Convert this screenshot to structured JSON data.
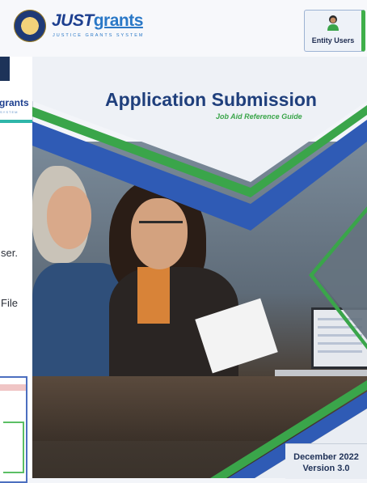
{
  "header": {
    "logo_main": "JUST",
    "logo_grants": "grants",
    "logo_sub": "JUSTICE GRANTS SYSTEM",
    "entity_users_label": "Entity Users"
  },
  "inset": {
    "logo_fragment": "grants",
    "system_fragment": "SYSTEM",
    "text_line1": "ser.",
    "text_line2": "File"
  },
  "cover": {
    "title": "Application Submission",
    "subtitle": "Job Aid Reference Guide",
    "date": "December 2022",
    "version": "Version 3.0"
  },
  "colors": {
    "navy": "#1f3f7c",
    "blue_band": "#2f5bb5",
    "green": "#3aa54a",
    "gray_band": "#5f6a78"
  },
  "icons": {
    "seal": "doj-seal-icon",
    "user": "user-avatar-icon"
  }
}
